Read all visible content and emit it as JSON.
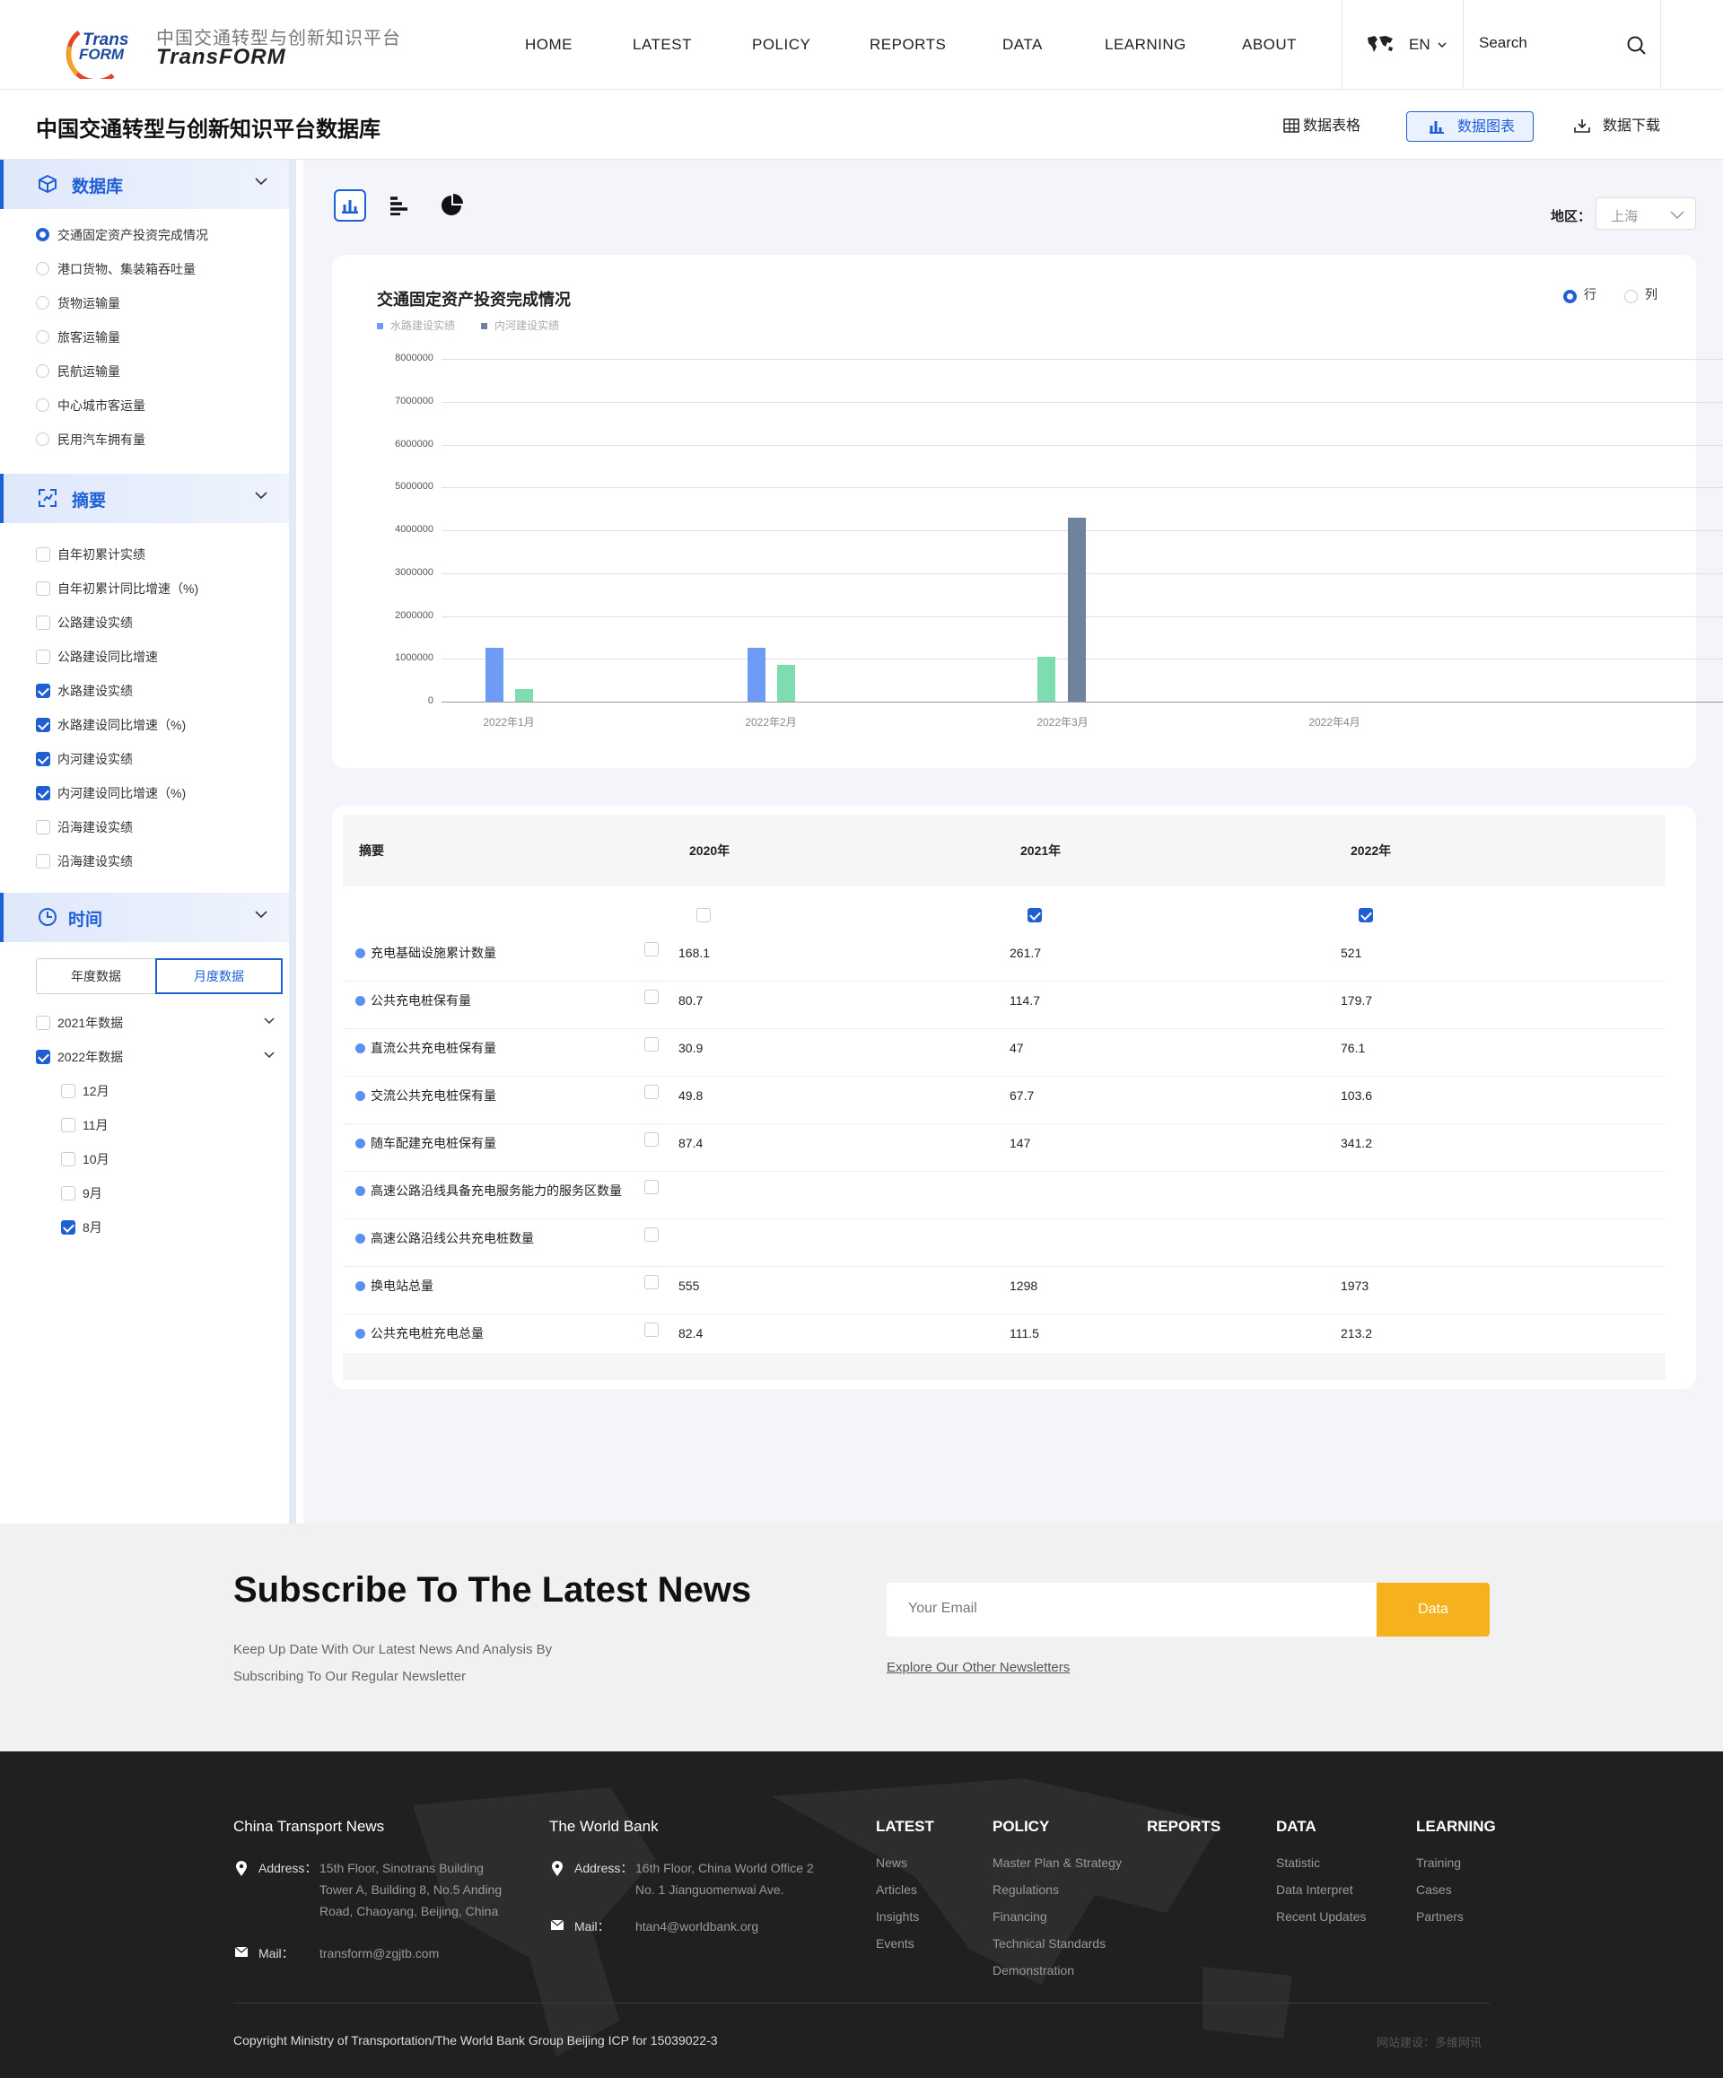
{
  "header": {
    "logo_text": "Trans FORM",
    "site_name_cn": "中国交通转型与创新知识平台",
    "site_name_en": "TransFORM",
    "nav": [
      "HOME",
      "LATEST",
      "POLICY",
      "REPORTS",
      "DATA",
      "LEARNING",
      "ABOUT"
    ],
    "lang": "EN",
    "search_placeholder": "Search"
  },
  "page": {
    "title": "中国交通转型与创新知识平台数据库",
    "views": [
      "数据表格",
      "数据图表",
      "数据下载"
    ],
    "active_view": "数据图表"
  },
  "sidebar": {
    "db": {
      "title": "数据库",
      "items": [
        "交通固定资产投资完成情况",
        "港口货物、集装箱吞吐量",
        "货物运输量",
        "旅客运输量",
        "民航运输量",
        "中心城市客运量",
        "民用汽车拥有量"
      ],
      "selected": 0
    },
    "summary": {
      "title": "摘要",
      "items": [
        {
          "label": "自年初累计实绩",
          "checked": false
        },
        {
          "label": "自年初累计同比增速（%)",
          "checked": false
        },
        {
          "label": "公路建设实绩",
          "checked": false
        },
        {
          "label": "公路建设同比增速",
          "checked": false
        },
        {
          "label": "水路建设实绩",
          "checked": true
        },
        {
          "label": "水路建设同比增速（%)",
          "checked": true
        },
        {
          "label": "内河建设实绩",
          "checked": true
        },
        {
          "label": "内河建设同比增速（%)",
          "checked": true
        },
        {
          "label": "沿海建设实绩",
          "checked": false
        },
        {
          "label": "沿海建设实绩",
          "checked": false
        }
      ]
    },
    "time": {
      "title": "时间",
      "tabs": [
        "年度数据",
        "月度数据"
      ],
      "active_tab": "月度数据",
      "years": [
        {
          "label": "2021年数据",
          "checked": false
        },
        {
          "label": "2022年数据",
          "checked": true
        }
      ],
      "months": [
        {
          "label": "12月",
          "checked": false
        },
        {
          "label": "11月",
          "checked": false
        },
        {
          "label": "10月",
          "checked": false
        },
        {
          "label": "9月",
          "checked": false
        },
        {
          "label": "8月",
          "checked": true
        }
      ]
    }
  },
  "toolbar": {
    "region_label": "地区：",
    "region_value": "上海"
  },
  "chart_data": {
    "type": "bar",
    "title": "交通固定资产投资完成情况",
    "categories": [
      "2022年1月",
      "2022年2月",
      "2022年3月",
      "2022年4月"
    ],
    "series": [
      {
        "name": "水路建设实绩",
        "color": "#6e9cf5",
        "values": [
          1250000,
          1250000,
          null,
          null
        ]
      },
      {
        "name": "内河建设实绩",
        "color": "#7ddcb0",
        "values": [
          300000,
          850000,
          1050000,
          null
        ]
      },
      {
        "name": "",
        "color": "#6f829e",
        "values": [
          null,
          null,
          4300000,
          null
        ]
      }
    ],
    "ylim": [
      0,
      8000000
    ],
    "yticks": [
      "8000000",
      "7000000",
      "6000000",
      "5000000",
      "4000000",
      "3000000",
      "2000000",
      "1000000",
      "0"
    ],
    "grid": true,
    "legend_position": "top-left",
    "orient": {
      "options": [
        "行",
        "列"
      ],
      "selected": "行"
    }
  },
  "table": {
    "headers": [
      "摘要",
      "2020年",
      "2021年",
      "2022年"
    ],
    "header_checks": [
      false,
      true,
      true
    ],
    "rows": [
      {
        "label": "充电基础设施累计数量",
        "v": [
          "168.1",
          "261.7",
          "521"
        ]
      },
      {
        "label": "公共充电桩保有量",
        "v": [
          "80.7",
          "114.7",
          "179.7"
        ]
      },
      {
        "label": "直流公共充电桩保有量",
        "v": [
          "30.9",
          "47",
          "76.1"
        ]
      },
      {
        "label": "交流公共充电桩保有量",
        "v": [
          "49.8",
          "67.7",
          "103.6"
        ]
      },
      {
        "label": "随车配建充电桩保有量",
        "v": [
          "87.4",
          "147",
          "341.2"
        ]
      },
      {
        "label": "高速公路沿线具备充电服务能力的服务区数量",
        "v": [
          "",
          "",
          ""
        ]
      },
      {
        "label": "高速公路沿线公共充电桩数量",
        "v": [
          "",
          "",
          ""
        ]
      },
      {
        "label": "换电站总量",
        "v": [
          "555",
          "1298",
          "1973"
        ]
      },
      {
        "label": "公共充电桩充电总量",
        "v": [
          "82.4",
          "111.5",
          "213.2"
        ]
      }
    ]
  },
  "subscribe": {
    "title": "Subscribe To The Latest News",
    "desc1": "Keep Up Date With Our Latest News And Analysis By",
    "desc2": "Subscribing To Our Regular Newsletter",
    "email_placeholder": "Your Email",
    "button": "Data",
    "other_link": "Explore Our Other Newsletters"
  },
  "footer": {
    "col1": {
      "title": "China Transport News",
      "addr_key": "Address：",
      "addr": [
        "15th Floor, Sinotrans Building",
        "Tower A, Building 8, No.5 Anding",
        "Road, Chaoyang, Beijing, China"
      ],
      "mail_key": "Mail：",
      "mail": "transform@zgjtb.com"
    },
    "col2": {
      "title": "The World Bank",
      "addr_key": "Address：",
      "addr": [
        "16th Floor, China World Office 2",
        "No. 1 Jianguomenwai Ave."
      ],
      "mail_key": "Mail：",
      "mail": "htan4@worldbank.org"
    },
    "latest": {
      "title": "LATEST",
      "items": [
        "News",
        "Articles",
        "Insights",
        "Events"
      ]
    },
    "policy": {
      "title": "POLICY",
      "items": [
        "Master Plan & Strategy",
        "Regulations",
        "Financing",
        "Technical Standards",
        "Demonstration"
      ]
    },
    "reports": {
      "title": "REPORTS"
    },
    "data": {
      "title": "DATA",
      "items": [
        "Statistic",
        "Data Interpret",
        "Recent Updates"
      ]
    },
    "learning": {
      "title": "LEARNING",
      "items": [
        "Training",
        "Cases",
        "Partners"
      ]
    },
    "copyright": "Copyright Ministry of Transportation/The World Bank Group Beijing ICP for 15039022-3",
    "credit": "网站建设：多维网讯"
  }
}
